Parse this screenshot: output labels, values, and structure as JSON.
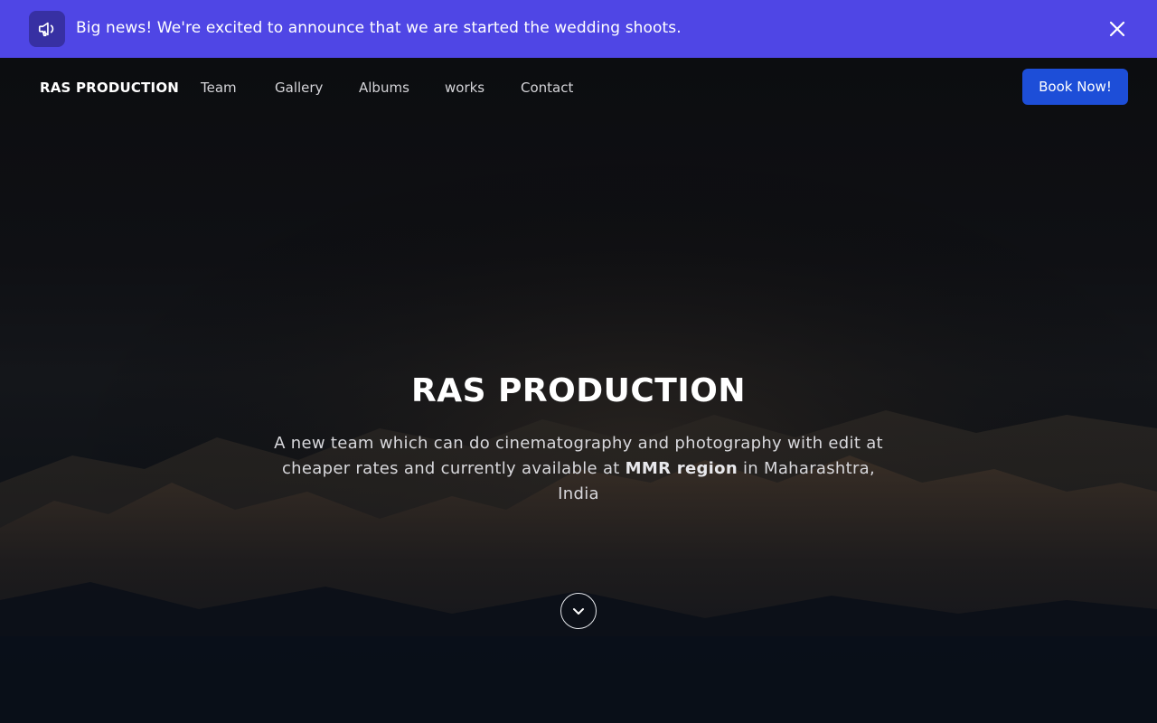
{
  "announcement": {
    "text": "Big news! We're excited to announce that we are started the wedding shoots.",
    "icon": "megaphone-icon",
    "close_icon": "close-icon",
    "background_color": "#4f46e5"
  },
  "nav": {
    "brand": "RAS PRODUCTION",
    "links": [
      "Team",
      "Gallery",
      "Albums",
      "works",
      "Contact"
    ],
    "cta_label": "Book Now!",
    "cta_color": "#1d4ed8"
  },
  "hero": {
    "title": "RAS PRODUCTION",
    "description_part1": "A new team which can do cinematography and photography with edit at cheaper rates and currently available at ",
    "description_bold": "MMR region",
    "description_part2": " in Maharashtra, India",
    "scroll_icon": "chevron-down-icon"
  }
}
